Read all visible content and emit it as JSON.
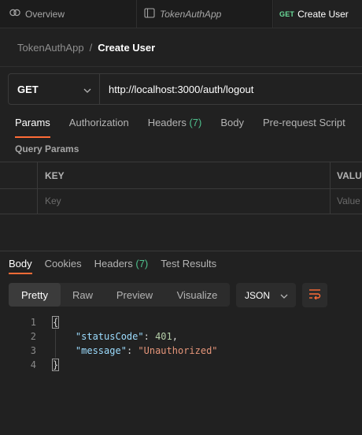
{
  "tabs": [
    {
      "label": "Overview",
      "icon": "overview-icon"
    },
    {
      "label": "TokenAuthApp",
      "icon": "collection-icon"
    },
    {
      "method": "GET",
      "label": "Create User",
      "active": true
    }
  ],
  "breadcrumb": {
    "parent": "TokenAuthApp",
    "separator": "/",
    "current": "Create User"
  },
  "request": {
    "method": "GET",
    "url": "http://localhost:3000/auth/logout"
  },
  "request_tabs": [
    {
      "label": "Params",
      "active": true
    },
    {
      "label": "Authorization"
    },
    {
      "label": "Headers",
      "count": "(7)"
    },
    {
      "label": "Body"
    },
    {
      "label": "Pre-request Script"
    }
  ],
  "query_params": {
    "title": "Query Params",
    "columns": [
      "KEY",
      "VALU"
    ],
    "placeholders": {
      "key": "Key",
      "value": "Value"
    }
  },
  "response_tabs": [
    {
      "label": "Body",
      "active": true
    },
    {
      "label": "Cookies"
    },
    {
      "label": "Headers",
      "count": "(7)"
    },
    {
      "label": "Test Results"
    }
  ],
  "view_modes": [
    {
      "label": "Pretty",
      "active": true
    },
    {
      "label": "Raw"
    },
    {
      "label": "Preview"
    },
    {
      "label": "Visualize"
    }
  ],
  "format": "JSON",
  "response_body": {
    "line_numbers": [
      "1",
      "2",
      "3",
      "4"
    ],
    "open_brace": "{",
    "close_brace": "}",
    "fields": [
      {
        "key": "\"statusCode\"",
        "value": "401",
        "type": "number",
        "trail": ","
      },
      {
        "key": "\"message\"",
        "value": "\"Unauthorized\"",
        "type": "string",
        "trail": ""
      }
    ]
  },
  "colors": {
    "accent": "#ff6c37",
    "method_get": "#6bdd9a",
    "count": "#4fc08d",
    "json_key": "#9cdcfe",
    "json_number": "#b5cea8",
    "json_string": "#e6967a"
  }
}
